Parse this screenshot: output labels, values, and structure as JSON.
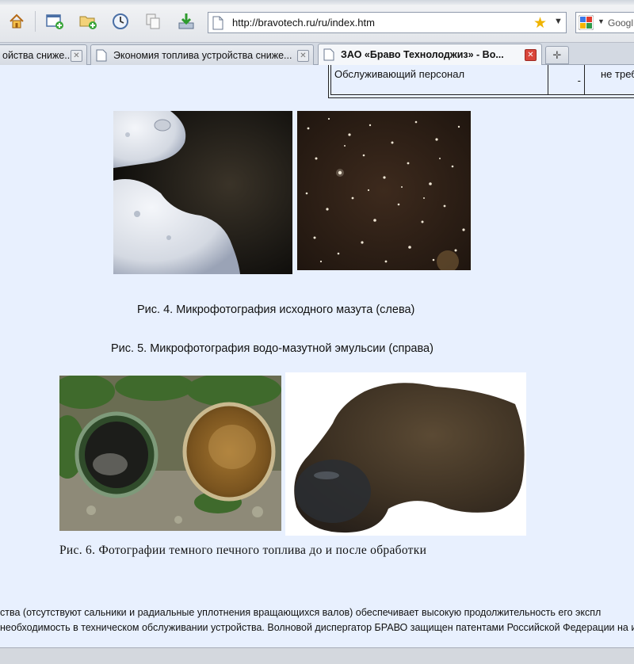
{
  "browser": {
    "address": {
      "url": "http://bravotech.ru/ru/index.htm"
    },
    "search": {
      "placeholder": "Googl"
    },
    "tabs": [
      {
        "label": "ойства сниже...",
        "active": false
      },
      {
        "label": "Экономия топлива устройства сниже...",
        "active": false
      },
      {
        "label": "ЗАО «Браво Технолоджиз» - Во...",
        "active": true
      }
    ]
  },
  "page": {
    "table_row": {
      "col1": "Обслуживающий персонал",
      "col2": "-",
      "col3": "не треб"
    },
    "captions": {
      "fig4": "Рис. 4. Микрофотография исходного мазута (слева)",
      "fig5": "Рис. 5. Микрофотография водо-мазутной эмульсии (справа)",
      "fig6": "Рис. 6. Фотографии темного печного топлива до и после обработки"
    },
    "paragraph": {
      "line1": "ства (отсутствуют сальники и радиальные уплотнения вращающихся валов) обеспечивает высокую продолжительность его экспл",
      "line2": "необходимость в техническом обслуживании устройства. Волновой диспергатор БРАВО защищен патентами Российской Федерации на и"
    }
  },
  "colors": {
    "page_bg": "#e8f0fe",
    "active_tab_close": "#d9453a",
    "bookmark_star": "#f0b400"
  }
}
